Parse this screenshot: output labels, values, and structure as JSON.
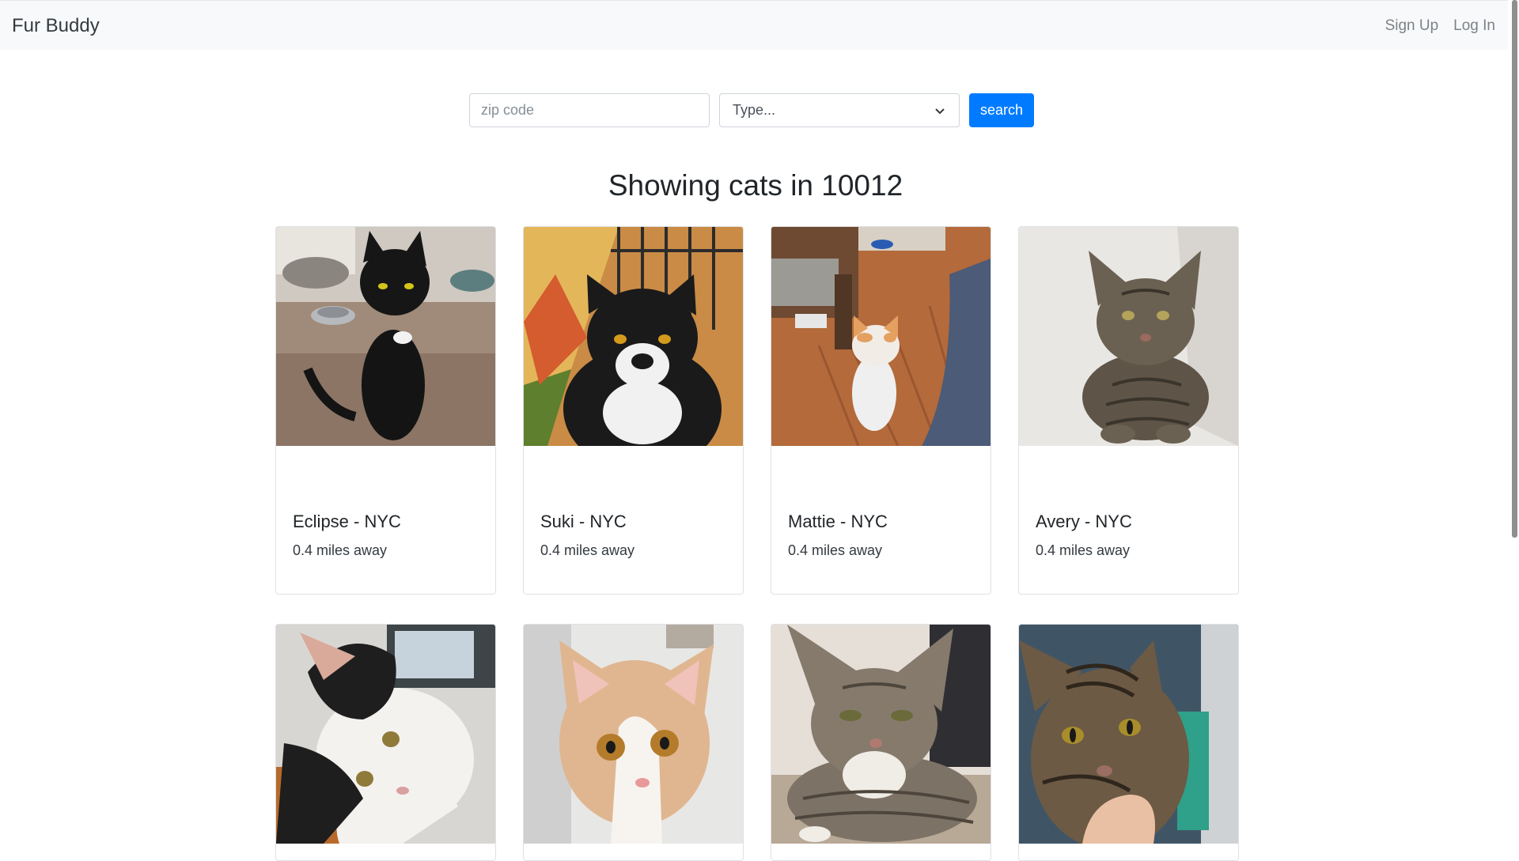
{
  "nav": {
    "brand": "Fur Buddy",
    "links": [
      {
        "label": "Sign Up"
      },
      {
        "label": "Log In"
      }
    ]
  },
  "search": {
    "zip_placeholder": "zip code",
    "zip_value": "",
    "type_selected": "Type...",
    "button_label": "search"
  },
  "heading": "Showing cats in 10012",
  "pets": [
    {
      "name": "Eclipse - NYC",
      "distance": "0.4 miles away",
      "photo": "black-cat-photo"
    },
    {
      "name": "Suki - NYC",
      "distance": "0.4 miles away",
      "photo": "tuxedo-cat-photo"
    },
    {
      "name": "Mattie - NYC",
      "distance": "0.4 miles away",
      "photo": "orange-white-cat-photo"
    },
    {
      "name": "Avery - NYC",
      "distance": "0.4 miles away",
      "photo": "tabby-cat-photo"
    },
    {
      "name": "",
      "distance": "",
      "photo": "black-white-cat-photo"
    },
    {
      "name": "",
      "distance": "",
      "photo": "orange-white-kitten-photo"
    },
    {
      "name": "",
      "distance": "",
      "photo": "gray-tabby-cat-photo"
    },
    {
      "name": "",
      "distance": "",
      "photo": "brown-tabby-cat-photo"
    }
  ],
  "colors": {
    "primary": "#007bff",
    "navbar_bg": "#f8f9fa"
  }
}
